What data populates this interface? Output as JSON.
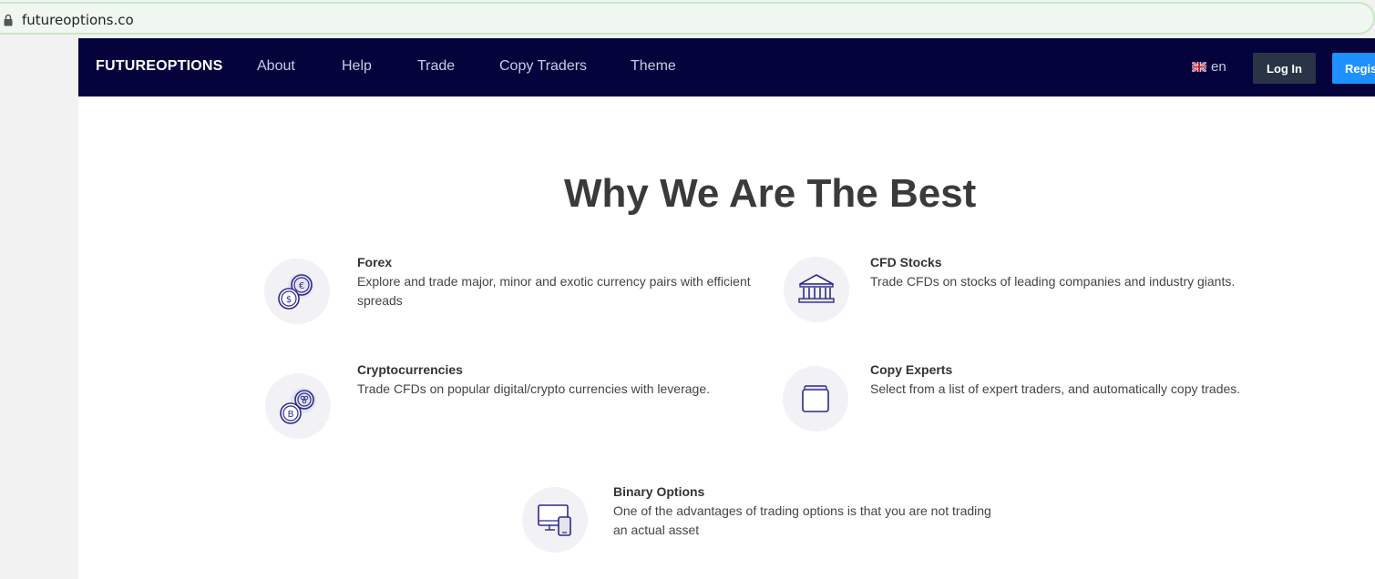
{
  "browser": {
    "url": "futureoptions.co"
  },
  "navbar": {
    "brand": "FUTUREOPTIONS",
    "links": [
      "About",
      "Help",
      "Trade",
      "Copy Traders",
      "Theme"
    ],
    "language": "en",
    "login_label": "Log In",
    "register_label": "Regis"
  },
  "section": {
    "title": "Why We Are The Best",
    "features": [
      {
        "title": "Forex",
        "description": "Explore and trade major, minor and exotic currency pairs with efficient spreads",
        "icon": "coins-icon"
      },
      {
        "title": "CFD Stocks",
        "description": "Trade CFDs on stocks of leading companies and industry giants.",
        "icon": "bank-icon"
      },
      {
        "title": "Cryptocurrencies",
        "description": "Trade CFDs on popular digital/crypto currencies with leverage.",
        "icon": "crypto-coins-icon"
      },
      {
        "title": "Copy Experts",
        "description": "Select from a list of expert traders, and automatically copy trades.",
        "icon": "wallet-icon"
      },
      {
        "title": "Binary Options",
        "description": "One of the advantages of trading options is that you are not trading an actual asset",
        "icon": "devices-icon"
      }
    ]
  },
  "colors": {
    "navbar_bg": "#04033b",
    "login_bg": "#2a3447",
    "register_bg": "#1e90ff",
    "icon_stroke": "#2e2a8a"
  }
}
